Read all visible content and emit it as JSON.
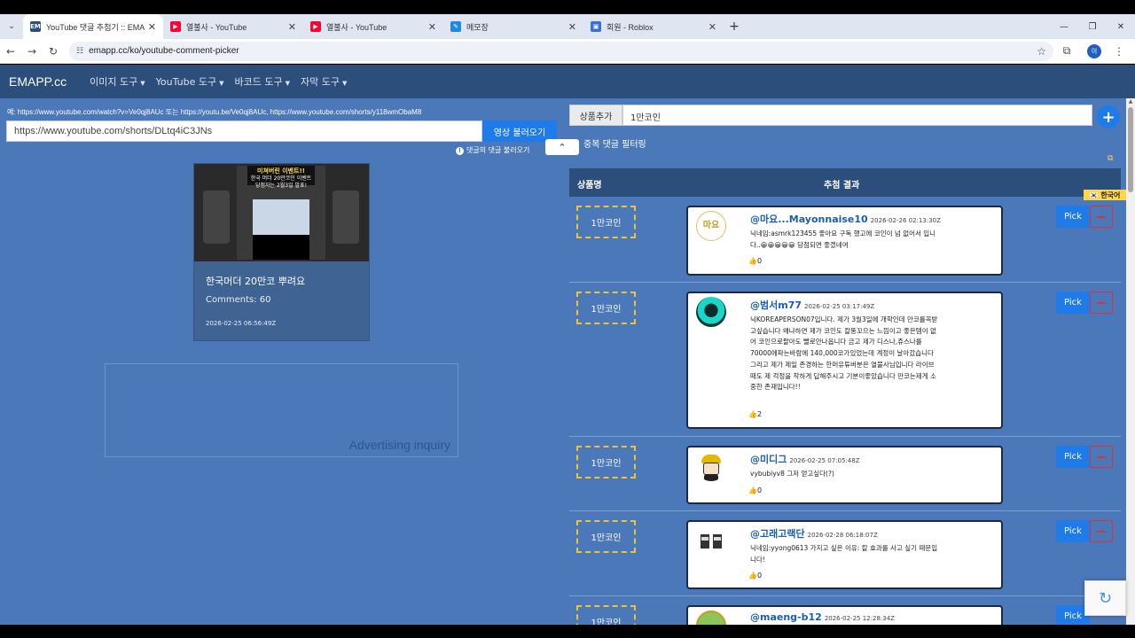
{
  "browser": {
    "tabs": [
      {
        "favicon": "EM",
        "favicon_color": "#2c4e7b",
        "title": "YouTube 댓글 추첨기 :: EMAPP",
        "active": true
      },
      {
        "favicon": "▶",
        "favicon_color": "#ff0033",
        "title": "열불사 - YouTube",
        "active": false
      },
      {
        "favicon": "▶",
        "favicon_color": "#ff0033",
        "title": "열불사 - YouTube",
        "active": false
      },
      {
        "favicon": "✎",
        "favicon_color": "#1e88e5",
        "title": "메모장",
        "active": false
      },
      {
        "favicon": "▣",
        "favicon_color": "#3b6fd8",
        "title": "회원 - Roblox",
        "active": false
      }
    ],
    "new_tab": "+",
    "url": "emapp.cc/ko/youtube-comment-picker",
    "profile_initial": "이"
  },
  "navbar": {
    "brand": "EMAPP.cc",
    "items": [
      "이미지 도구",
      "YouTube 도구",
      "바코드 도구",
      "자막 도구"
    ]
  },
  "left": {
    "example": "예: https://www.youtube.com/watch?v=Ve0qj8AUc 또는 https://youtu.be/Ve0qj8AUc, https://www.youtube.com/shorts/y118wmObaM8",
    "url_value": "https://www.youtube.com/shorts/DLtq4iC3JNs",
    "load_button": "영상 불러오기",
    "load_all": "댓글의 댓글 불러오기",
    "video": {
      "thumb_banner_1": "미쳐버린 이벤트!!",
      "thumb_banner_2": "한국 머더 20만코인 이벤트",
      "thumb_banner_3": "당첨자는 2월3일 발표!",
      "title": "한국머더 20만코 뿌려요",
      "comments": "Comments: 60",
      "date": "2026-02-25 06:56:49Z"
    },
    "ad_text": "Advertising inquiry"
  },
  "right": {
    "product_label": "상품추가",
    "product_value": "1만코인",
    "add_button": "+",
    "filter_label": "중복 댓글 필터링",
    "col_name": "상품명",
    "col_result": "추첨 결과",
    "lang_badge": "🇰🇷 한국어",
    "pick_label": "Pick",
    "remove_label": "−",
    "rows": [
      {
        "prize": "1만코인",
        "author": "@마요...Mayonnaise10",
        "date": "2026-02-26 02:13:30Z",
        "text": "닉네임:asmrk123455 좋아요 구독 했고에 코인이 넘 없어서 입니다..😀😀😀😀😀 당첨되면 좋겠네여",
        "likes": "0",
        "avatar": "마요"
      },
      {
        "prize": "1만코인",
        "author": "@범서m77",
        "date": "2026-02-25 03:17:49Z",
        "text": "닉KOREAPERSON07입니다. 제가 3월3일에 개학인데 만코를꼭받고싶습니다 왜냐하면 제가 코인도 칼똥꼬으는 느낌이고 좋은템이 없어 코인으로팔아도 빨로안나옵니다 금고 제가 디스나,쥬스나를 70000에파는바람에 140,000코가있었는데 계정이 날아갔습니다 그리고 제가 제일 존경하는 한머유튜버분은 열불사님입니다 라이브 때도 제 걱정을 착하게 답해주시고 기분이좋았습니다 만코는제게 소중한 존재입니다!!",
        "likes": "2",
        "avatar": ""
      },
      {
        "prize": "1만코인",
        "author": "@미디그",
        "date": "2026-02-25 07:05:48Z",
        "text": "vybubiyv8 그저 얻고싶다(?)",
        "likes": "0",
        "avatar": ""
      },
      {
        "prize": "1만코인",
        "author": "@고래고랙단",
        "date": "2026-02-28 06:18:07Z",
        "text": "닉네임:yyong0613 가지고 싶은 이유: 칼 효과를 사고 싶기 때문입니다!",
        "likes": "0",
        "avatar": ""
      },
      {
        "prize": "1만코인",
        "author": "@maeng-b12",
        "date": "2026-02-25 12:28:34Z",
        "text": "",
        "likes": "",
        "avatar": ""
      }
    ]
  }
}
